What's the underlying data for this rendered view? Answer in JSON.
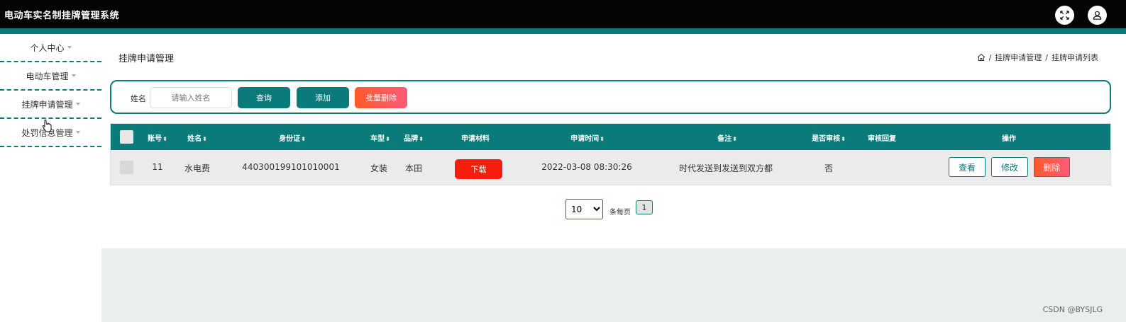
{
  "app": {
    "title": "电动车实名制挂牌管理系统"
  },
  "topbar": {
    "icons": [
      "fullscreen-icon",
      "user-icon"
    ]
  },
  "sidebar": {
    "items": [
      {
        "label": "个人中心"
      },
      {
        "label": "电动车管理"
      },
      {
        "label": "挂牌申请管理"
      },
      {
        "label": "处罚信息管理"
      }
    ]
  },
  "page": {
    "title": "挂牌申请管理",
    "breadcrumb": [
      "挂牌申请管理",
      "挂牌申请列表"
    ]
  },
  "search": {
    "label": "姓名",
    "placeholder": "请输入姓名",
    "query_label": "查询",
    "add_label": "添加",
    "batch_delete_label": "批量删除"
  },
  "table": {
    "columns": [
      "账号",
      "姓名",
      "身份证",
      "车型",
      "品牌",
      "申请材料",
      "申请时间",
      "备注",
      "是否审核",
      "审核回复",
      "操作"
    ],
    "rows": [
      {
        "account": "11",
        "name": "水电费",
        "id_card": "440300199101010001",
        "car_type": "女装",
        "brand": "本田",
        "material_button": "下载",
        "apply_time": "2022-03-08 08:30:26",
        "remark": "时代发送到发送到双方都",
        "reviewed": "否",
        "review_reply": "",
        "actions": {
          "view": "查看",
          "edit": "修改",
          "delete": "删除"
        }
      }
    ]
  },
  "pagination": {
    "page_size": "10",
    "page_size_options": [
      "10"
    ],
    "per_page_label": "条每页",
    "current_page": "1"
  },
  "watermark": "CSDN @BYSJLG",
  "colors": {
    "primary": "#0b7a7a",
    "danger": "#f61c0e",
    "topbar": "#050505"
  }
}
